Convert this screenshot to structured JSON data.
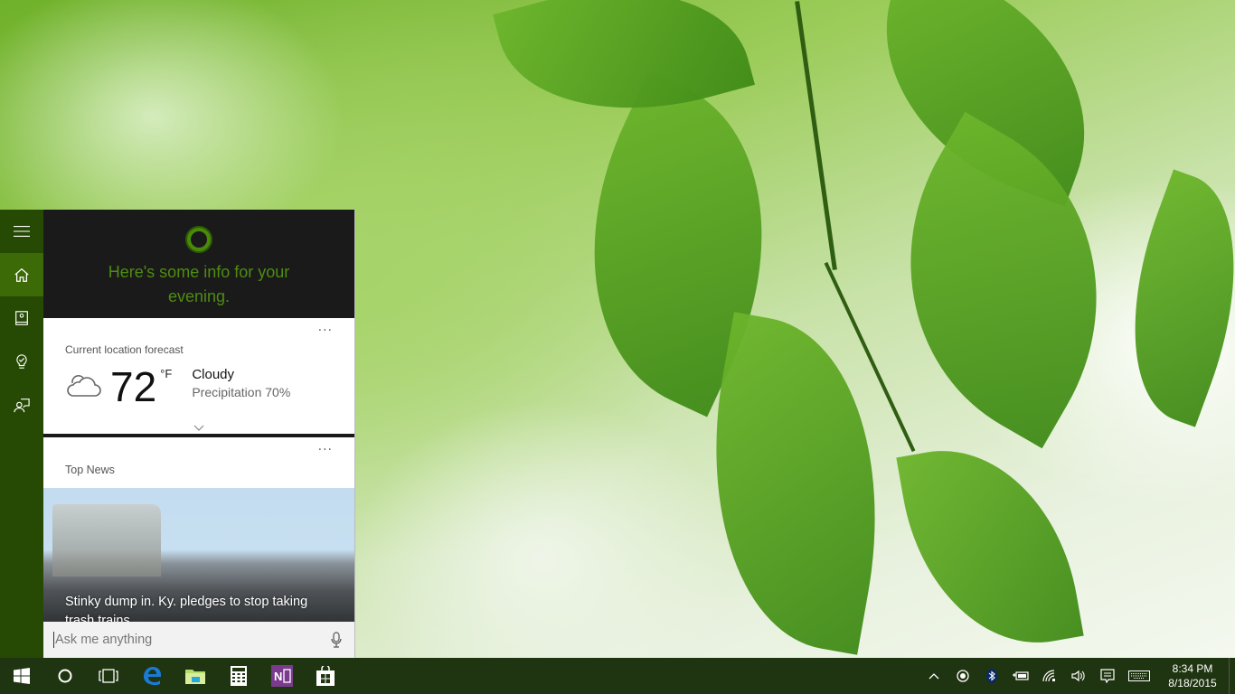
{
  "cortana": {
    "rail": [
      {
        "name": "menu",
        "icon": "hamburger-icon"
      },
      {
        "name": "home",
        "icon": "home-icon",
        "active": true
      },
      {
        "name": "notebook",
        "icon": "notebook-icon"
      },
      {
        "name": "reminders",
        "icon": "lightbulb-icon"
      },
      {
        "name": "feedback",
        "icon": "feedback-icon"
      }
    ],
    "greeting": "Here's some info for your evening.",
    "weather": {
      "label": "Current location forecast",
      "more": "···",
      "icon": "cloud-icon",
      "temperature": "72",
      "unit": "°F",
      "condition": "Cloudy",
      "precipitation": "Precipitation 70%"
    },
    "news": {
      "label": "Top News",
      "more": "···",
      "headline": "Stinky dump in. Ky. pledges to stop taking trash trains"
    },
    "search": {
      "placeholder": "Ask me anything",
      "value": ""
    }
  },
  "taskbar": {
    "apps": [
      {
        "name": "start",
        "icon": "windows-logo-icon"
      },
      {
        "name": "cortana",
        "icon": "cortana-circle-icon"
      },
      {
        "name": "task-view",
        "icon": "task-view-icon"
      },
      {
        "name": "edge",
        "icon": "edge-icon"
      },
      {
        "name": "file-explorer",
        "icon": "folder-icon"
      },
      {
        "name": "calculator",
        "icon": "calculator-icon"
      },
      {
        "name": "onenote",
        "icon": "onenote-icon"
      },
      {
        "name": "store",
        "icon": "store-icon"
      }
    ],
    "tray": [
      "chevron-up-icon",
      "record-icon",
      "bluetooth-icon",
      "battery-icon",
      "wifi-icon",
      "volume-icon",
      "action-center-icon",
      "keyboard-icon"
    ],
    "time": "8:34 PM",
    "date": "8/18/2015"
  },
  "colors": {
    "accent": "#4f8c10",
    "rail": "#264a04",
    "rail_active": "#3b6a06",
    "taskbar": "#1f3410"
  }
}
